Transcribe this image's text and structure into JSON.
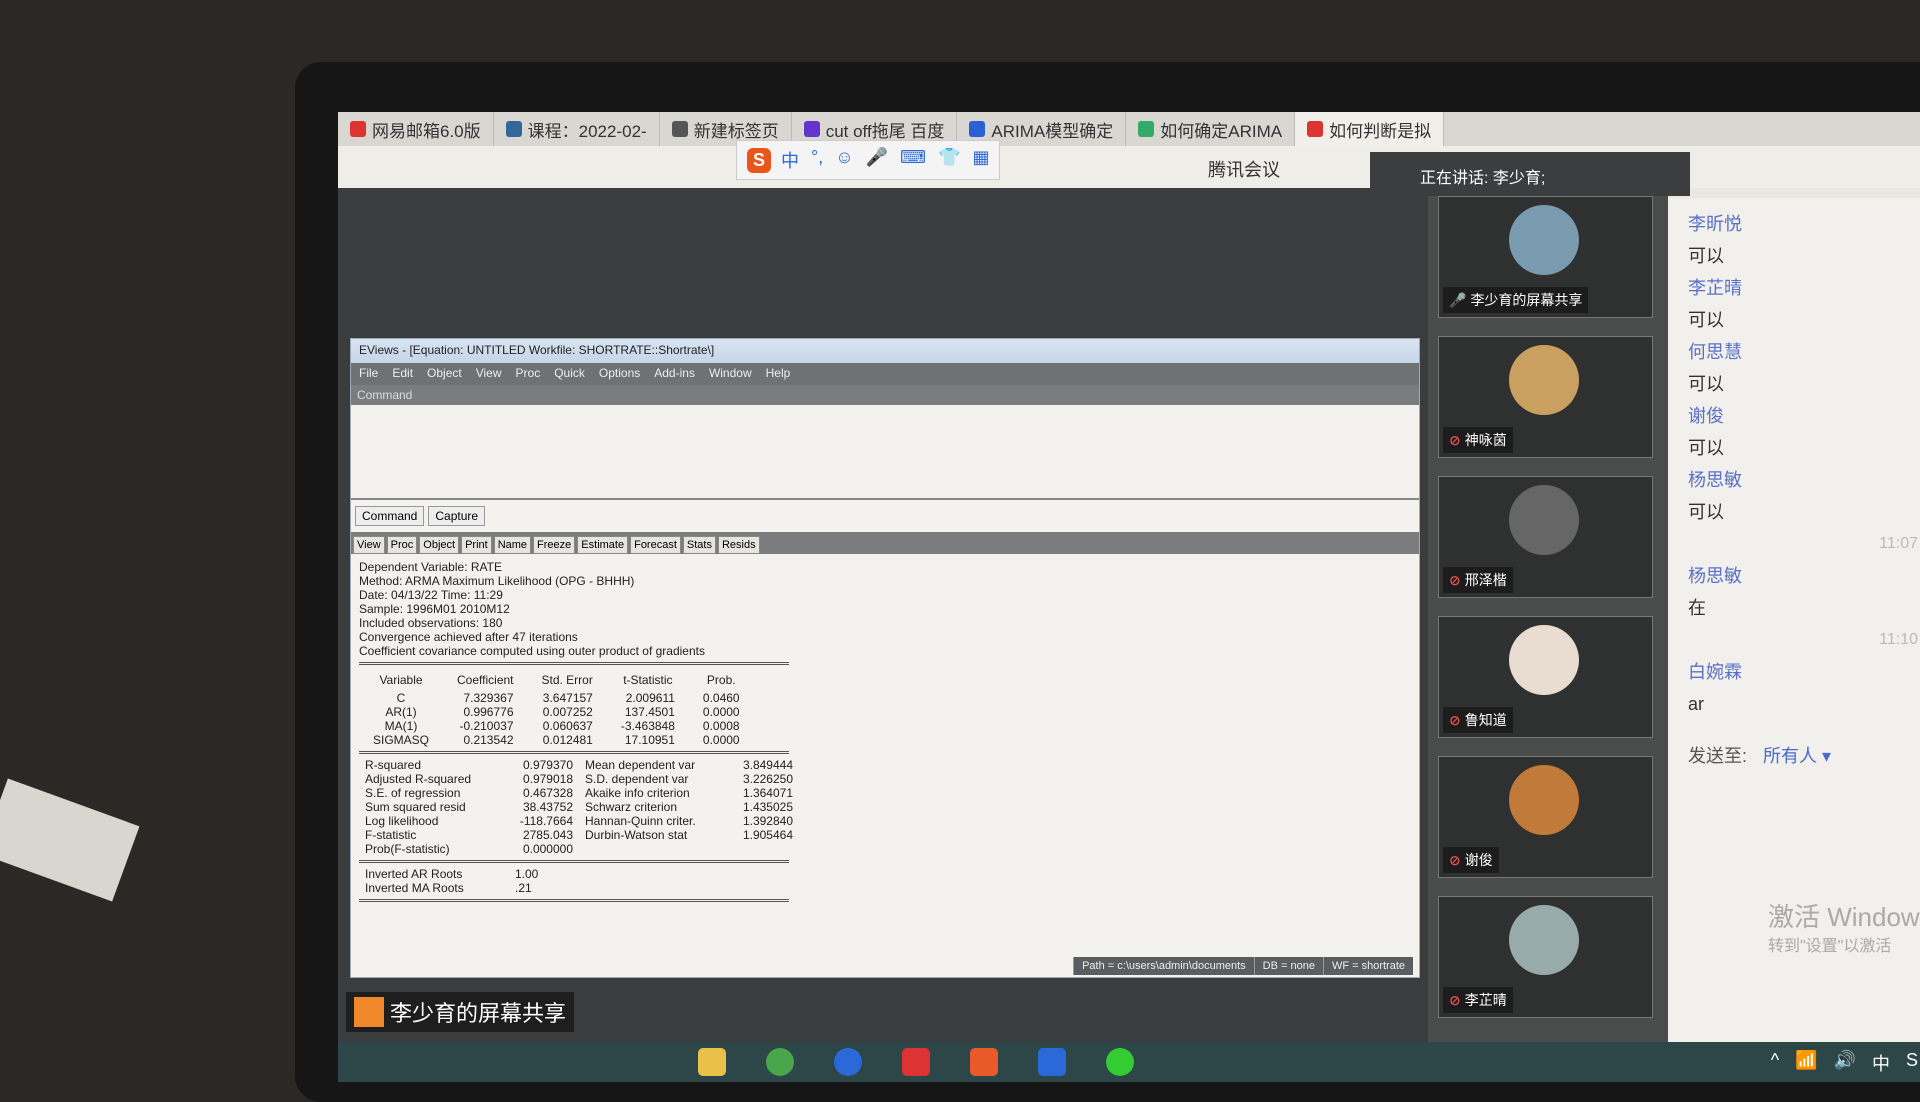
{
  "browser": {
    "tabs": [
      "网易邮箱6.0版",
      "课程：2022-02-",
      "新建标签页",
      "cut off拖尾 百度",
      "ARIMA模型确定",
      "如何确定ARIMA",
      "如何判断是拟"
    ],
    "tab_colors": [
      "#d33",
      "#369",
      "#555",
      "#63c",
      "#2b5fd6",
      "#3a6",
      "#d33"
    ]
  },
  "ime": {
    "logo": "S",
    "items": [
      "中",
      "°,",
      "☺",
      "🎤",
      "⌨",
      "👕",
      "▦"
    ]
  },
  "meeting": {
    "title": "腾讯会议",
    "speaking": "正在讲话: 李少育;",
    "share_label": "李少育的屏幕共享"
  },
  "eviews": {
    "title": "EViews - [Equation: UNTITLED   Workfile: SHORTRATE::Shortrate\\]",
    "menu": [
      "File",
      "Edit",
      "Object",
      "View",
      "Proc",
      "Quick",
      "Options",
      "Add-ins",
      "Window",
      "Help"
    ],
    "command_header": "Command",
    "cmd_tabs": [
      "Command",
      "Capture"
    ],
    "eq_buttons": [
      "View",
      "Proc",
      "Object",
      "Print",
      "Name",
      "Freeze",
      "Estimate",
      "Forecast",
      "Stats",
      "Resids"
    ],
    "header_lines": [
      "Dependent Variable: RATE",
      "Method: ARMA Maximum Likelihood (OPG - BHHH)",
      "Date: 04/13/22   Time: 11:29",
      "Sample: 1996M01 2010M12",
      "Included observations: 180",
      "Convergence achieved after 47 iterations",
      "Coefficient covariance computed using outer product of gradients"
    ],
    "columns": [
      "Variable",
      "Coefficient",
      "Std. Error",
      "t-Statistic",
      "Prob."
    ],
    "rows": [
      [
        "C",
        "7.329367",
        "3.647157",
        "2.009611",
        "0.0460"
      ],
      [
        "AR(1)",
        "0.996776",
        "0.007252",
        "137.4501",
        "0.0000"
      ],
      [
        "MA(1)",
        "-0.210037",
        "0.060637",
        "-3.463848",
        "0.0008"
      ],
      [
        "SIGMASQ",
        "0.213542",
        "0.012481",
        "17.10951",
        "0.0000"
      ]
    ],
    "stats": [
      [
        "R-squared",
        "0.979370",
        "Mean dependent var",
        "3.849444"
      ],
      [
        "Adjusted R-squared",
        "0.979018",
        "S.D. dependent var",
        "3.226250"
      ],
      [
        "S.E. of regression",
        "0.467328",
        "Akaike info criterion",
        "1.364071"
      ],
      [
        "Sum squared resid",
        "38.43752",
        "Schwarz criterion",
        "1.435025"
      ],
      [
        "Log likelihood",
        "-118.7664",
        "Hannan-Quinn criter.",
        "1.392840"
      ],
      [
        "F-statistic",
        "2785.043",
        "Durbin-Watson stat",
        "1.905464"
      ],
      [
        "Prob(F-statistic)",
        "0.000000",
        "",
        ""
      ]
    ],
    "roots": [
      [
        "Inverted AR Roots",
        "1.00"
      ],
      [
        "Inverted MA Roots",
        ".21"
      ]
    ],
    "status": [
      "Path = c:\\users\\admin\\documents",
      "DB = none",
      "WF = shortrate"
    ]
  },
  "participants": [
    {
      "name": "李少育的屏幕共享",
      "color": "#7a9ab0"
    },
    {
      "name": "神咏茵",
      "color": "#c9a060"
    },
    {
      "name": "邢泽楷",
      "color": "#666"
    },
    {
      "name": "鲁知道",
      "color": "#e8ddd0"
    },
    {
      "name": "谢俊",
      "color": "#c07a3a"
    },
    {
      "name": "李芷晴",
      "color": "#9aa"
    }
  ],
  "chat": {
    "messages": [
      {
        "name": "李昕悦",
        "text": "可以"
      },
      {
        "name": "李芷晴",
        "text": "可以"
      },
      {
        "name": "何思慧",
        "text": "可以"
      },
      {
        "name": "谢俊",
        "text": "可以"
      },
      {
        "name": "杨思敏",
        "text": "可以"
      }
    ],
    "time1": "11:07",
    "messages2": [
      {
        "name": "杨思敏",
        "text": "在"
      }
    ],
    "time2": "11:10",
    "messages3": [
      {
        "name": "白婉霖",
        "text": "ar"
      }
    ],
    "send_to_label": "发送至:",
    "send_to_value": "所有人 ▾"
  },
  "watermark": {
    "line1": "激活 Windows",
    "line2": "转到\"设置\"以激活"
  },
  "tray": [
    "^",
    "📶",
    "🔊",
    "中",
    "S"
  ]
}
